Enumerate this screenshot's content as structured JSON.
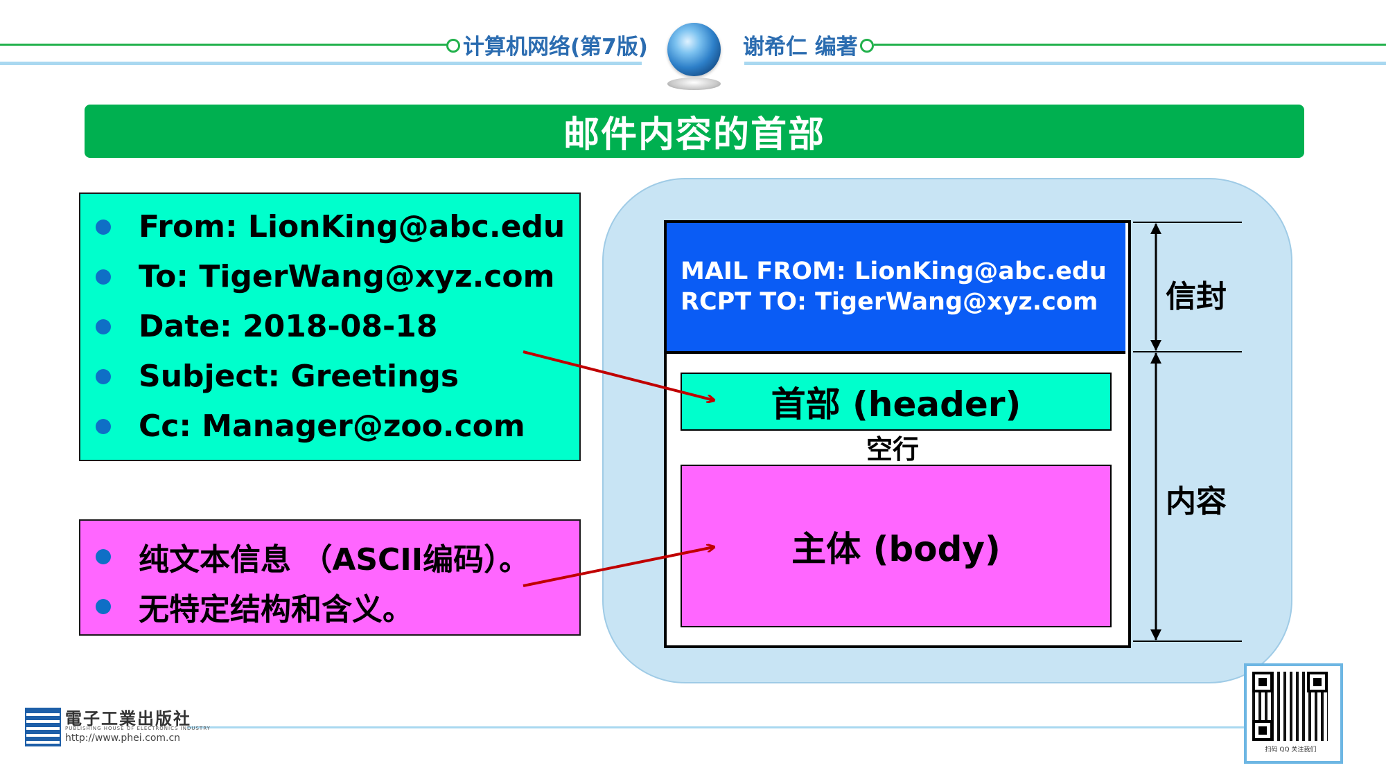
{
  "header": {
    "book_title": "计算机网络(第7版)",
    "author": "谢希仁 编著"
  },
  "slide": {
    "title": "邮件内容的首部"
  },
  "left_top_box": {
    "items": [
      "From: LionKing@abc.edu",
      "To: TigerWang@xyz.com",
      "Date: 2018-08-18",
      "Subject: Greetings",
      "Cc: Manager@zoo.com"
    ]
  },
  "left_bottom_box": {
    "items": [
      "纯文本信息 （ASCII编码）。",
      "无特定结构和含义。"
    ]
  },
  "diagram": {
    "envelope_lines": [
      "MAIL FROM: LionKing@abc.edu",
      "RCPT TO: TigerWang@xyz.com"
    ],
    "header_label": "首部 (header)",
    "blank_line_label": "空行",
    "body_label": "主体 (body)",
    "side_envelope": "信封",
    "side_content": "内容"
  },
  "footer": {
    "publisher": "電子工業出版社",
    "publisher_en": "PUBLISHING HOUSE OF ELECTRONICS INDUSTRY",
    "url": "http://www.phei.com.cn",
    "qr_caption": "扫码 QQ 关注我们"
  },
  "colors": {
    "title_green": "#00b050",
    "cyan": "#00ffcc",
    "magenta": "#ff66ff",
    "envelope_blue": "#0a5cf5",
    "arrow_red": "#c00000",
    "header_blue": "#2b6cb0"
  }
}
